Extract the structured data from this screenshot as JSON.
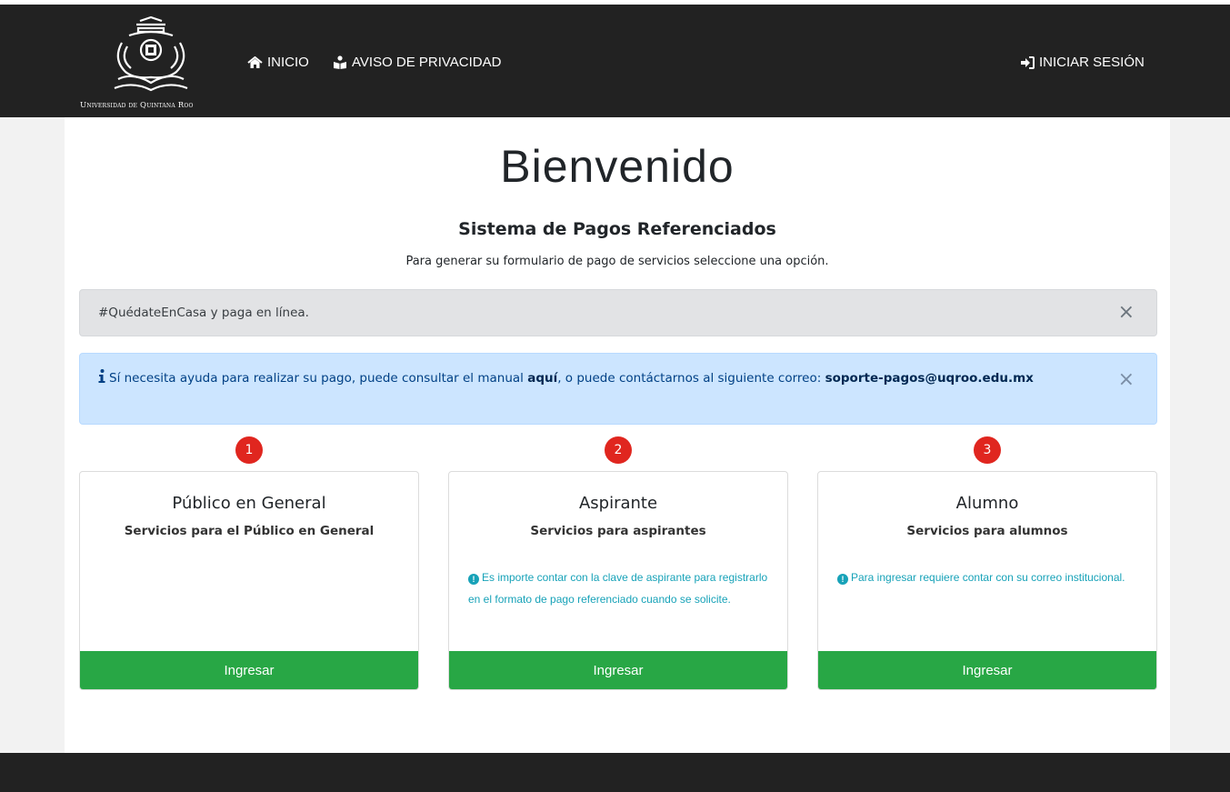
{
  "header": {
    "logo_text": "Universidad de Quintana Roo",
    "nav": [
      {
        "label": "INICIO",
        "icon": "home-icon"
      },
      {
        "label": "AVISO DE PRIVACIDAD",
        "icon": "reader-icon"
      }
    ],
    "login_label": "INICIAR SESIÓN"
  },
  "main": {
    "title": "Bienvenido",
    "subtitle": "Sistema de Pagos Referenciados",
    "lead": "Para generar su formulario de pago de servicios seleccione una opción."
  },
  "alerts": {
    "gray_text": "#QuédateEnCasa y paga en línea.",
    "info": {
      "prefix": "Sí necesita ayuda para realizar su pago, puede consultar el manual ",
      "link": "aquí",
      "middle": ", o puede contáctarnos al siguiente correo: ",
      "email": "soporte-pagos@uqroo.edu.mx"
    },
    "close_glyph": "×"
  },
  "cards": [
    {
      "number": "1",
      "title": "Público en General",
      "subtitle": "Servicios para el Público en General",
      "note": "",
      "button": "Ingresar"
    },
    {
      "number": "2",
      "title": "Aspirante",
      "subtitle": "Servicios para aspirantes",
      "note": "Es importe contar con la clave de aspirante para registrarlo en el formato de pago referenciado cuando se solicite.",
      "button": "Ingresar"
    },
    {
      "number": "3",
      "title": "Alumno",
      "subtitle": "Servicios para alumnos",
      "note": "Para ingresar requiere contar con su correo institucional.",
      "button": "Ingresar"
    }
  ],
  "colors": {
    "navbar": "#222222",
    "success": "#28a745",
    "badge": "#e0261f",
    "info_bg": "#cce5ff",
    "note_text": "#17a2b8"
  }
}
